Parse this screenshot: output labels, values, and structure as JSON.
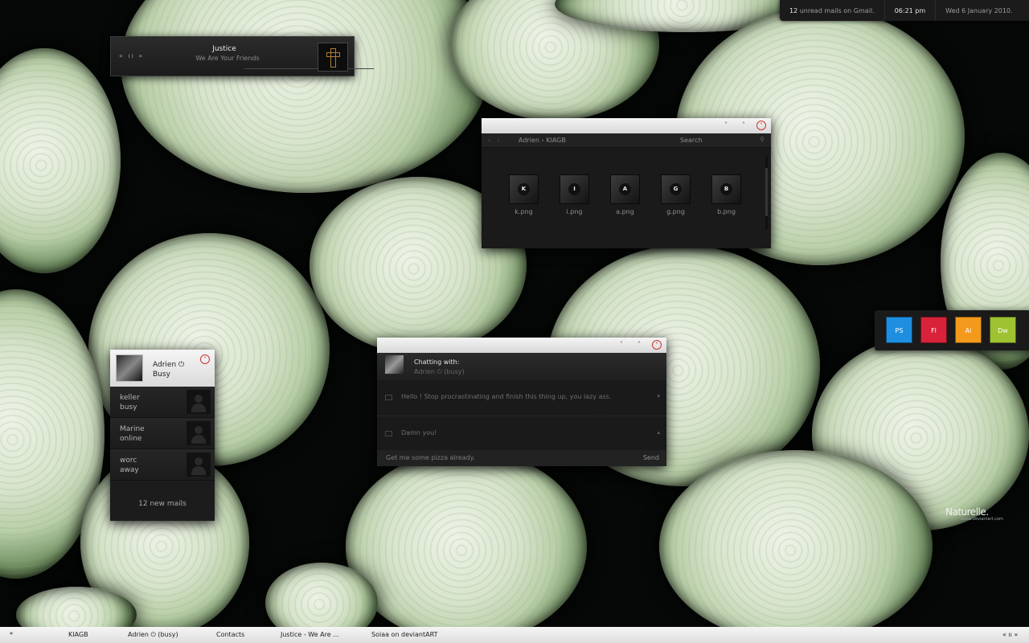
{
  "top_bar": {
    "unread_count": "12",
    "unread_text": "unread mails on Gmail.",
    "time": "06:21 pm",
    "date": "Wed 6 January 2010."
  },
  "music_player": {
    "controls": "« ıı »",
    "artist": "Justice",
    "track": "We Are Your Friends",
    "album_icon": "cross-icon"
  },
  "explorer": {
    "nav_back": "‹",
    "nav_forward": "›",
    "breadcrumb": "Adrien › KIAGB",
    "search_placeholder": "Search",
    "files": [
      {
        "glyph": "K",
        "name": "k.png"
      },
      {
        "glyph": "I",
        "name": "i.png"
      },
      {
        "glyph": "A",
        "name": "a.png"
      },
      {
        "glyph": "G",
        "name": "g.png"
      },
      {
        "glyph": "B",
        "name": "b.png"
      }
    ]
  },
  "contacts": {
    "user_name": "Adrien ⏻",
    "user_status": "Busy",
    "list": [
      {
        "name": "keller",
        "state": "busy"
      },
      {
        "name": "Marine",
        "state": "online"
      },
      {
        "name": "worc",
        "state": "away"
      }
    ],
    "new_mails": "12 new mails"
  },
  "chat": {
    "title": "Chatting with:",
    "subtitle": "Adrien ⏻ (busy)",
    "messages": [
      {
        "text": "Hello ! Stop procrastinating and finish this thing up, you lazy ass.",
        "arrow": "▾"
      },
      {
        "text": "Damn you!",
        "arrow": "▴"
      }
    ],
    "input_value": "Get me some pizza already.",
    "send_label": "Send"
  },
  "dock": {
    "apps": [
      {
        "label": "PS",
        "color": "#1e8fe0"
      },
      {
        "label": "Fl",
        "color": "#d8223a"
      },
      {
        "label": "Ai",
        "color": "#f39a1c"
      },
      {
        "label": "Dw",
        "color": "#9fc232"
      }
    ]
  },
  "watermark": {
    "text": "Naturelle.",
    "subtext": "soiaa.deviantart.com"
  },
  "taskbar": {
    "start": "*",
    "items": [
      "KIAGB",
      "Adrien ⏻ (busy)",
      "Contacts",
      "Justice - We Are ...",
      "Soiaa on deviantART"
    ],
    "right": "« ıı »"
  },
  "titlebar_buttons": {
    "minimize": "˅",
    "maximize": "˄",
    "close": "˅"
  }
}
